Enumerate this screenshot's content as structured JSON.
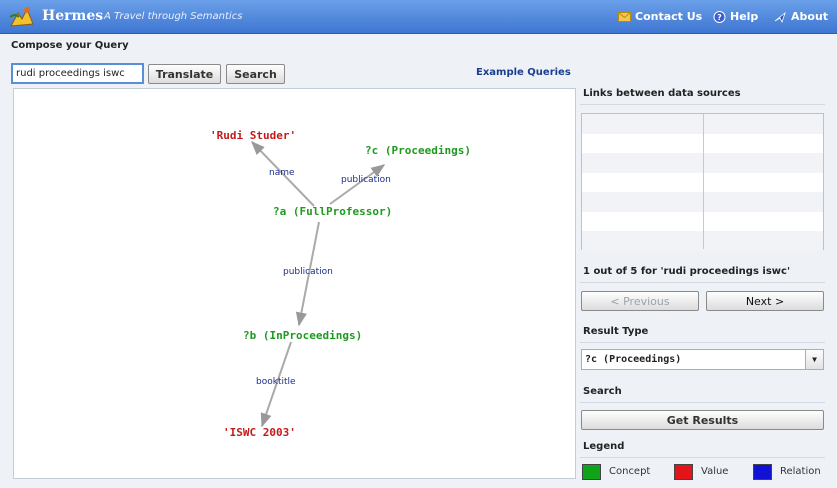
{
  "header": {
    "title": "Hermes",
    "subtitle": "A Travel through Semantics",
    "links": {
      "contact": "Contact Us",
      "help": "Help",
      "about": "About"
    }
  },
  "compose": {
    "label": "Compose your Query",
    "query_value": "rudi proceedings iswc",
    "translate_label": "Translate",
    "search_label": "Search",
    "example_queries_label": "Example Queries"
  },
  "graph": {
    "nodes": {
      "rudi": "'Rudi Studer'",
      "proceedings": "?c (Proceedings)",
      "fullprofessor": "?a (FullProfessor)",
      "inproceedings": "?b (InProceedings)",
      "iswc": "'ISWC 2003'"
    },
    "edges": {
      "name": "name",
      "publication_top": "publication",
      "publication_mid": "publication",
      "booktitle": "booktitle"
    }
  },
  "panel": {
    "links_heading": "Links between data sources",
    "result_count": "1 out of 5 for 'rudi proceedings iswc'",
    "previous_label": "< Previous",
    "next_label": "Next >",
    "result_type_heading": "Result Type",
    "result_type_value": "?c (Proceedings)",
    "search_heading": "Search",
    "get_results_label": "Get Results",
    "legend_heading": "Legend",
    "legend": {
      "concept": "Concept",
      "value": "Value",
      "relation": "Relation"
    }
  },
  "colors": {
    "concept": "#11a31a",
    "value": "#e3151b",
    "relation": "#1212d4",
    "concept_text": "#1f9a1f",
    "value_text": "#c41a1a",
    "header": "#4a82dc"
  }
}
